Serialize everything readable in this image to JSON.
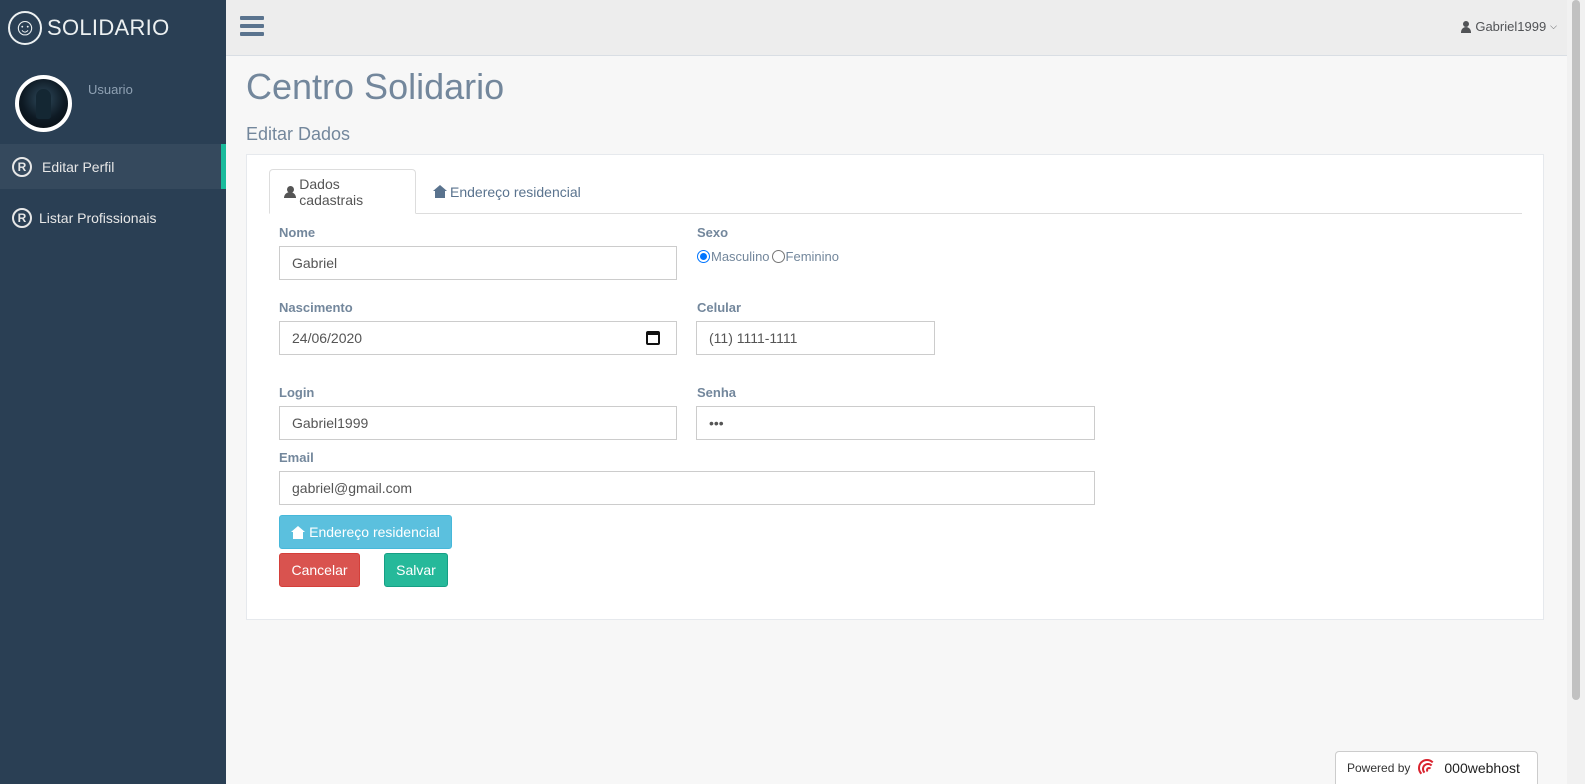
{
  "sidebar": {
    "brand": "SOLIDARIO",
    "brand_icon": "smiley-icon",
    "profile_label": "Usuario",
    "items": [
      {
        "label": "Editar Perfil",
        "icon": "registered-icon",
        "active": true
      },
      {
        "label": "Listar Profissionais",
        "icon": "registered-icon",
        "active": false
      }
    ]
  },
  "topnav": {
    "username": "Gabriel1999",
    "user_icon": "user-icon",
    "menu_icon": "hamburger-icon"
  },
  "main": {
    "title": "Centro Solidario",
    "subtitle": "Editar Dados",
    "tabs": [
      {
        "label": "Dados cadastrais",
        "icon": "user-icon",
        "active": true
      },
      {
        "label": "Endereço residencial",
        "icon": "home-icon",
        "active": false
      }
    ]
  },
  "form": {
    "nome": {
      "label": "Nome",
      "value": "Gabriel"
    },
    "sexo": {
      "label": "Sexo",
      "options": [
        "Masculino",
        "Feminino"
      ],
      "selected": "Masculino"
    },
    "nascimento": {
      "label": "Nascimento",
      "value": "24/06/2020"
    },
    "celular": {
      "label": "Celular",
      "value": "(11) 1111-1111"
    },
    "login": {
      "label": "Login",
      "value": "Gabriel1999"
    },
    "senha": {
      "label": "Senha",
      "value": "•••"
    },
    "email": {
      "label": "Email",
      "value": "gabriel@gmail.com"
    }
  },
  "buttons": {
    "address": "Endereço residencial",
    "cancel": "Cancelar",
    "save": "Salvar"
  },
  "footer": {
    "powered_by": "Powered by",
    "host": "000webhost"
  },
  "colors": {
    "sidebar_bg": "#2a3f54",
    "active_accent": "#1abb9c",
    "info": "#5bc0de",
    "danger": "#d9534f",
    "success": "#26b99a"
  }
}
